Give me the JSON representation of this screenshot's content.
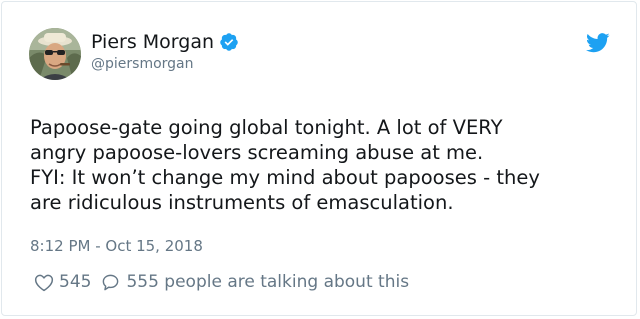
{
  "author": {
    "display_name": "Piers Morgan",
    "handle": "@piersmorgan",
    "verified": true
  },
  "icons": {
    "verified": "verified-badge-icon",
    "brand": "twitter-bird-icon",
    "like": "heart-icon",
    "reply": "speech-bubble-icon"
  },
  "colors": {
    "brand": "#1da1f2",
    "text": "#14171a",
    "muted": "#657786",
    "border": "#e1e8ed"
  },
  "tweet": {
    "lines": [
      "Papoose-gate going global tonight. A lot of VERY",
      "angry papoose-lovers screaming abuse at me.",
      "FYI: It won’t change my mind about papooses - they",
      "are ridiculous instruments of emasculation."
    ],
    "timestamp": "8:12 PM - Oct 15, 2018"
  },
  "engagement": {
    "likes": "545",
    "replies": "555 people are talking about this"
  }
}
